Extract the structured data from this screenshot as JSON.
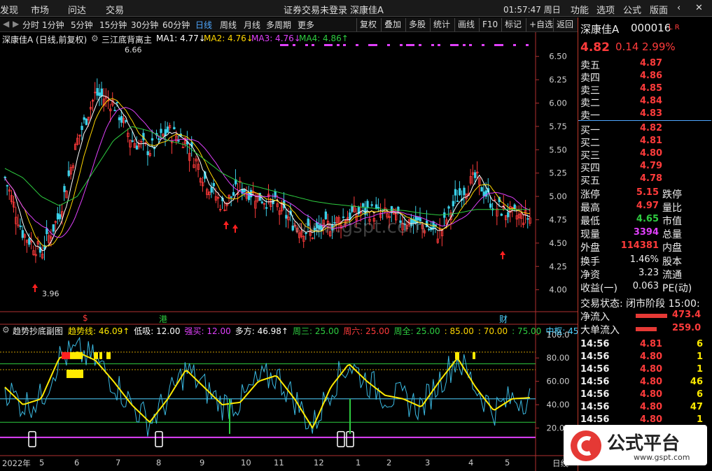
{
  "topbar": {
    "items": [
      "发现",
      "市场",
      "问达",
      "交易"
    ],
    "notice": "证券交易未登录",
    "stock_name": "深康佳A",
    "time": "01:57:47 周日",
    "menus": [
      "功能",
      "选项",
      "公式",
      "版面"
    ]
  },
  "toolbar": {
    "periods": [
      "分时",
      "1分钟",
      "5分钟",
      "15分钟",
      "30分钟",
      "60分钟",
      "日线",
      "周线",
      "月线",
      "多周期",
      "更多"
    ],
    "selected": "日线",
    "tools": [
      "复权",
      "叠加",
      "多股",
      "统计",
      "画线",
      "F10",
      "标记",
      "+自选",
      "返回"
    ]
  },
  "main": {
    "title": "深康佳A (日线,前复权)",
    "indicator": "三江底背离主",
    "ma": [
      {
        "k": "MA1: 4.77↓",
        "c": "#ffffff"
      },
      {
        "k": "MA2: 4.76↓",
        "c": "#ffd600"
      },
      {
        "k": "MA3: 4.76↓",
        "c": "#e040fb"
      },
      {
        "k": "MA4: 4.86↑",
        "c": "#2ecc40"
      }
    ],
    "high_label": "6.66",
    "low_label": "3.96",
    "yticks": [
      "6.50",
      "6.25",
      "6.00",
      "5.75",
      "5.50",
      "5.25",
      "5.00",
      "4.75",
      "4.50",
      "4.25",
      "4.00"
    ],
    "watermark": "www.gspt.com",
    "markers": [
      "$",
      "港",
      "财"
    ]
  },
  "sub": {
    "title": "趋势抄底副图",
    "items": [
      {
        "k": "趋势线: 46.09↑",
        "c": "#ffea00"
      },
      {
        "k": "低吸: 12.00",
        "c": "#ffffff"
      },
      {
        "k": "强买: 12.00",
        "c": "#e040fb"
      },
      {
        "k": "多方: 46.98↑",
        "c": "#ffffff"
      },
      {
        "k": "周三: 25.00",
        "c": "#2ecc40"
      },
      {
        "k": "周六: 25.00",
        "c": "#ff3b3b"
      },
      {
        "k": "周全: 25.00",
        "c": "#2ecc40"
      },
      {
        "k": ": 85.00",
        "c": "#ffd600"
      },
      {
        "k": ": 70.00",
        "c": "#ffd600"
      },
      {
        "k": ": 75.00",
        "c": "#2ecc40"
      },
      {
        "k": "中枢: 45.00",
        "c": "#4fd2ff"
      }
    ],
    "yticks": [
      "100.0",
      "80.00",
      "60.00",
      "40.00",
      "20.00"
    ]
  },
  "xaxis": {
    "labels": [
      "2022年",
      "5",
      "6",
      "7",
      "8",
      "9",
      "10",
      "11",
      "12",
      "1",
      "2",
      "3",
      "4",
      "5"
    ],
    "right": "日线"
  },
  "quote": {
    "name": "深康佳A",
    "code": "000016",
    "tag": "L R",
    "price": "4.82",
    "change": "0.14",
    "pct": "2.99%",
    "asks": [
      [
        "卖五",
        "4.87"
      ],
      [
        "卖四",
        "4.86"
      ],
      [
        "卖三",
        "4.85"
      ],
      [
        "卖二",
        "4.84"
      ],
      [
        "卖一",
        "4.83"
      ]
    ],
    "bids": [
      [
        "买一",
        "4.82"
      ],
      [
        "买二",
        "4.81"
      ],
      [
        "买三",
        "4.80"
      ],
      [
        "买四",
        "4.79"
      ],
      [
        "买五",
        "4.78"
      ]
    ],
    "stats": [
      [
        "涨停",
        "5.15",
        "跌停"
      ],
      [
        "最高",
        "4.97",
        "量比"
      ],
      [
        "最低",
        "4.65",
        "市值"
      ],
      [
        "现量",
        "3394",
        "总量"
      ],
      [
        "外盘",
        "114381",
        "内盘"
      ]
    ],
    "stats2": [
      [
        "换手",
        "1.46%",
        "股本"
      ],
      [
        "净资",
        "3.23",
        "流通"
      ],
      [
        "收益(一)",
        "0.063",
        "PE(动)"
      ]
    ],
    "status": "交易状态: 闭市阶段 15:00:",
    "flow": [
      [
        "净流入",
        "473.4"
      ],
      [
        "大单流入",
        "259.0"
      ]
    ],
    "ticks": [
      [
        "14:56",
        "4.81",
        "6"
      ],
      [
        "14:56",
        "4.80",
        "1"
      ],
      [
        "14:56",
        "4.80",
        "1"
      ],
      [
        "14:56",
        "4.80",
        "46"
      ],
      [
        "14:56",
        "4.80",
        "6"
      ],
      [
        "14:56",
        "4.80",
        "47"
      ],
      [
        "14:56",
        "4.80",
        "1"
      ]
    ]
  },
  "logo": {
    "text": "公式平台",
    "url": "www.gspt.com"
  },
  "chart_data": [
    {
      "type": "line",
      "title": "深康佳A (日线,前复权)",
      "ylim": [
        3.9,
        6.7
      ],
      "series": [
        {
          "name": "MA1",
          "values": [
            5.2,
            4.6,
            4.4,
            4.8,
            5.6,
            6.1,
            6.0,
            5.6,
            5.5,
            5.7,
            5.6,
            5.2,
            4.9,
            5.1,
            5.0,
            4.9,
            4.7,
            4.6,
            4.7,
            4.8,
            4.85,
            4.8,
            4.75,
            4.7,
            4.6,
            5.0,
            5.2,
            4.9,
            4.8,
            4.77
          ]
        },
        {
          "name": "MA4",
          "values": [
            5.3,
            5.2,
            5.0,
            4.9,
            5.0,
            5.3,
            5.6,
            5.75,
            5.7,
            5.6,
            5.55,
            5.4,
            5.25,
            5.15,
            5.1,
            5.05,
            5.0,
            4.95,
            4.92,
            4.9,
            4.88,
            4.86,
            4.85,
            4.82,
            4.8,
            4.82,
            4.86,
            4.86,
            4.86,
            4.86
          ]
        }
      ]
    },
    {
      "type": "line",
      "title": "趋势抄底副图",
      "ylim": [
        0,
        100
      ],
      "series": [
        {
          "name": "趋势线",
          "values": [
            55,
            40,
            45,
            80,
            85,
            78,
            60,
            40,
            25,
            45,
            70,
            55,
            40,
            42,
            60,
            65,
            45,
            20,
            55,
            75,
            60,
            48,
            45,
            38,
            60,
            80,
            55,
            35,
            45,
            46
          ]
        }
      ]
    }
  ]
}
